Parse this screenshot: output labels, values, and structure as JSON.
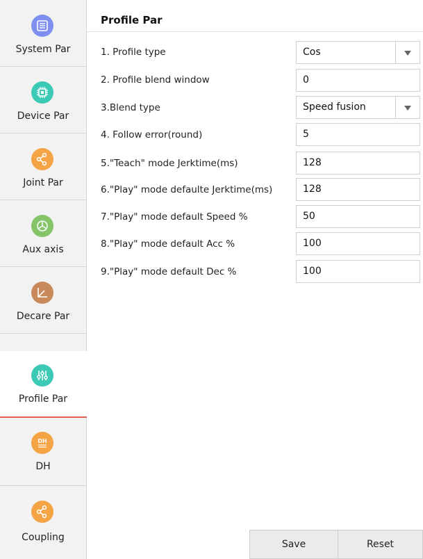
{
  "sidebar": {
    "items": [
      {
        "label": "System Par",
        "icon": "sliders-icon",
        "color": "#7f8ff0",
        "active": false
      },
      {
        "label": "Device Par",
        "icon": "chip-icon",
        "color": "#3cc9b5",
        "active": false
      },
      {
        "label": "Joint Par",
        "icon": "share-icon",
        "color": "#f4a444",
        "active": false
      },
      {
        "label": "Aux axis",
        "icon": "tri-circle-icon",
        "color": "#86c46a",
        "active": false
      },
      {
        "label": "Decare Par",
        "icon": "axes-icon",
        "color": "#c98a5b",
        "active": false
      },
      {
        "label": "Profile Par",
        "icon": "equalizer-icon",
        "color": "#3cc9b5",
        "active": true
      },
      {
        "label": "DH",
        "icon": "dh-icon",
        "color": "#f4a444",
        "active": false
      },
      {
        "label": "Coupling",
        "icon": "share-icon",
        "color": "#f4a444",
        "active": false
      }
    ]
  },
  "main": {
    "title": "Profile Par",
    "rows": [
      {
        "label": "1. Profile type",
        "value": "Cos",
        "type": "select"
      },
      {
        "label": "2. Profile blend window",
        "value": "0",
        "type": "input"
      },
      {
        "label": "3.Blend type",
        "value": "Speed fusion",
        "type": "select"
      },
      {
        "label": "4. Follow error(round)",
        "value": "5",
        "type": "input"
      },
      {
        "label": "5.\"Teach\" mode Jerktime(ms)",
        "value": "128",
        "type": "input"
      },
      {
        "label": "6.\"Play\" mode defaulte Jerktime(ms)",
        "value": "128",
        "type": "input"
      },
      {
        "label": "7.\"Play\" mode default Speed %",
        "value": "50",
        "type": "input"
      },
      {
        "label": "8.\"Play\" mode default Acc %",
        "value": "100",
        "type": "input"
      },
      {
        "label": "9.\"Play\" mode default Dec %",
        "value": "100",
        "type": "input"
      }
    ]
  },
  "footer": {
    "save_label": "Save",
    "reset_label": "Reset"
  }
}
